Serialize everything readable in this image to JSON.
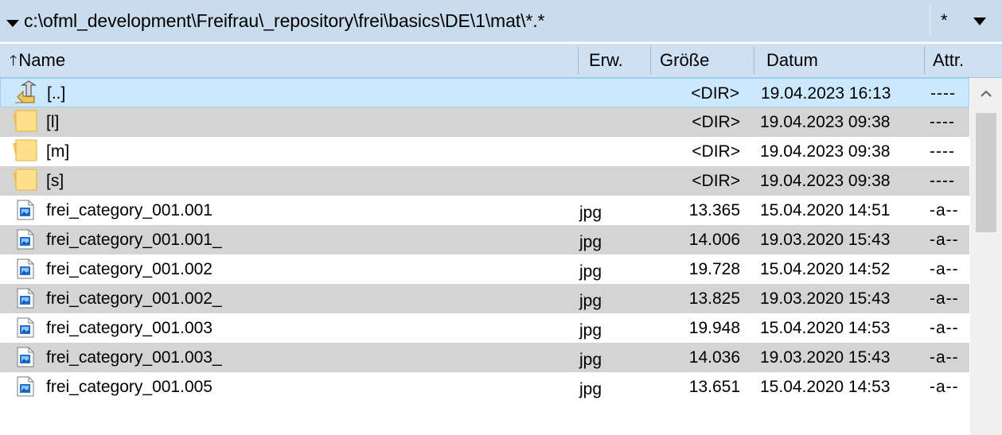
{
  "pathbar": {
    "path": "c:\\ofml_development\\Freifrau\\_repository\\frei\\basics\\DE\\1\\mat\\*.*",
    "filter_label": "*"
  },
  "columns": {
    "name": "Name",
    "ext": "Erw.",
    "size": "Größe",
    "date": "Datum",
    "attr": "Attr."
  },
  "rows": [
    {
      "type": "up",
      "name": "[..]",
      "ext": "",
      "size": "<DIR>",
      "date": "19.04.2023 16:13",
      "attr": "----"
    },
    {
      "type": "folder",
      "name": "[l]",
      "ext": "",
      "size": "<DIR>",
      "date": "19.04.2023 09:38",
      "attr": "----"
    },
    {
      "type": "folder",
      "name": "[m]",
      "ext": "",
      "size": "<DIR>",
      "date": "19.04.2023 09:38",
      "attr": "----"
    },
    {
      "type": "folder",
      "name": "[s]",
      "ext": "",
      "size": "<DIR>",
      "date": "19.04.2023 09:38",
      "attr": "----"
    },
    {
      "type": "file",
      "name": "frei_category_001.001",
      "ext": "jpg",
      "size": "13.365",
      "date": "15.04.2020 14:51",
      "attr": "-a--"
    },
    {
      "type": "file",
      "name": "frei_category_001.001_",
      "ext": "jpg",
      "size": "14.006",
      "date": "19.03.2020 15:43",
      "attr": "-a--"
    },
    {
      "type": "file",
      "name": "frei_category_001.002",
      "ext": "jpg",
      "size": "19.728",
      "date": "15.04.2020 14:52",
      "attr": "-a--"
    },
    {
      "type": "file",
      "name": "frei_category_001.002_",
      "ext": "jpg",
      "size": "13.825",
      "date": "19.03.2020 15:43",
      "attr": "-a--"
    },
    {
      "type": "file",
      "name": "frei_category_001.003",
      "ext": "jpg",
      "size": "19.948",
      "date": "15.04.2020 14:53",
      "attr": "-a--"
    },
    {
      "type": "file",
      "name": "frei_category_001.003_",
      "ext": "jpg",
      "size": "14.036",
      "date": "19.03.2020 15:43",
      "attr": "-a--"
    },
    {
      "type": "file",
      "name": "frei_category_001.005",
      "ext": "jpg",
      "size": "13.651",
      "date": "15.04.2020 14:53",
      "attr": "-a--"
    }
  ],
  "colors": {
    "pathbar_bg": "#c9dced",
    "header_bg": "#cfe0f3",
    "selected_row": "#cce8ff",
    "alt_row": "#d4d4d4",
    "folder_yellow": "#ffe08a"
  }
}
